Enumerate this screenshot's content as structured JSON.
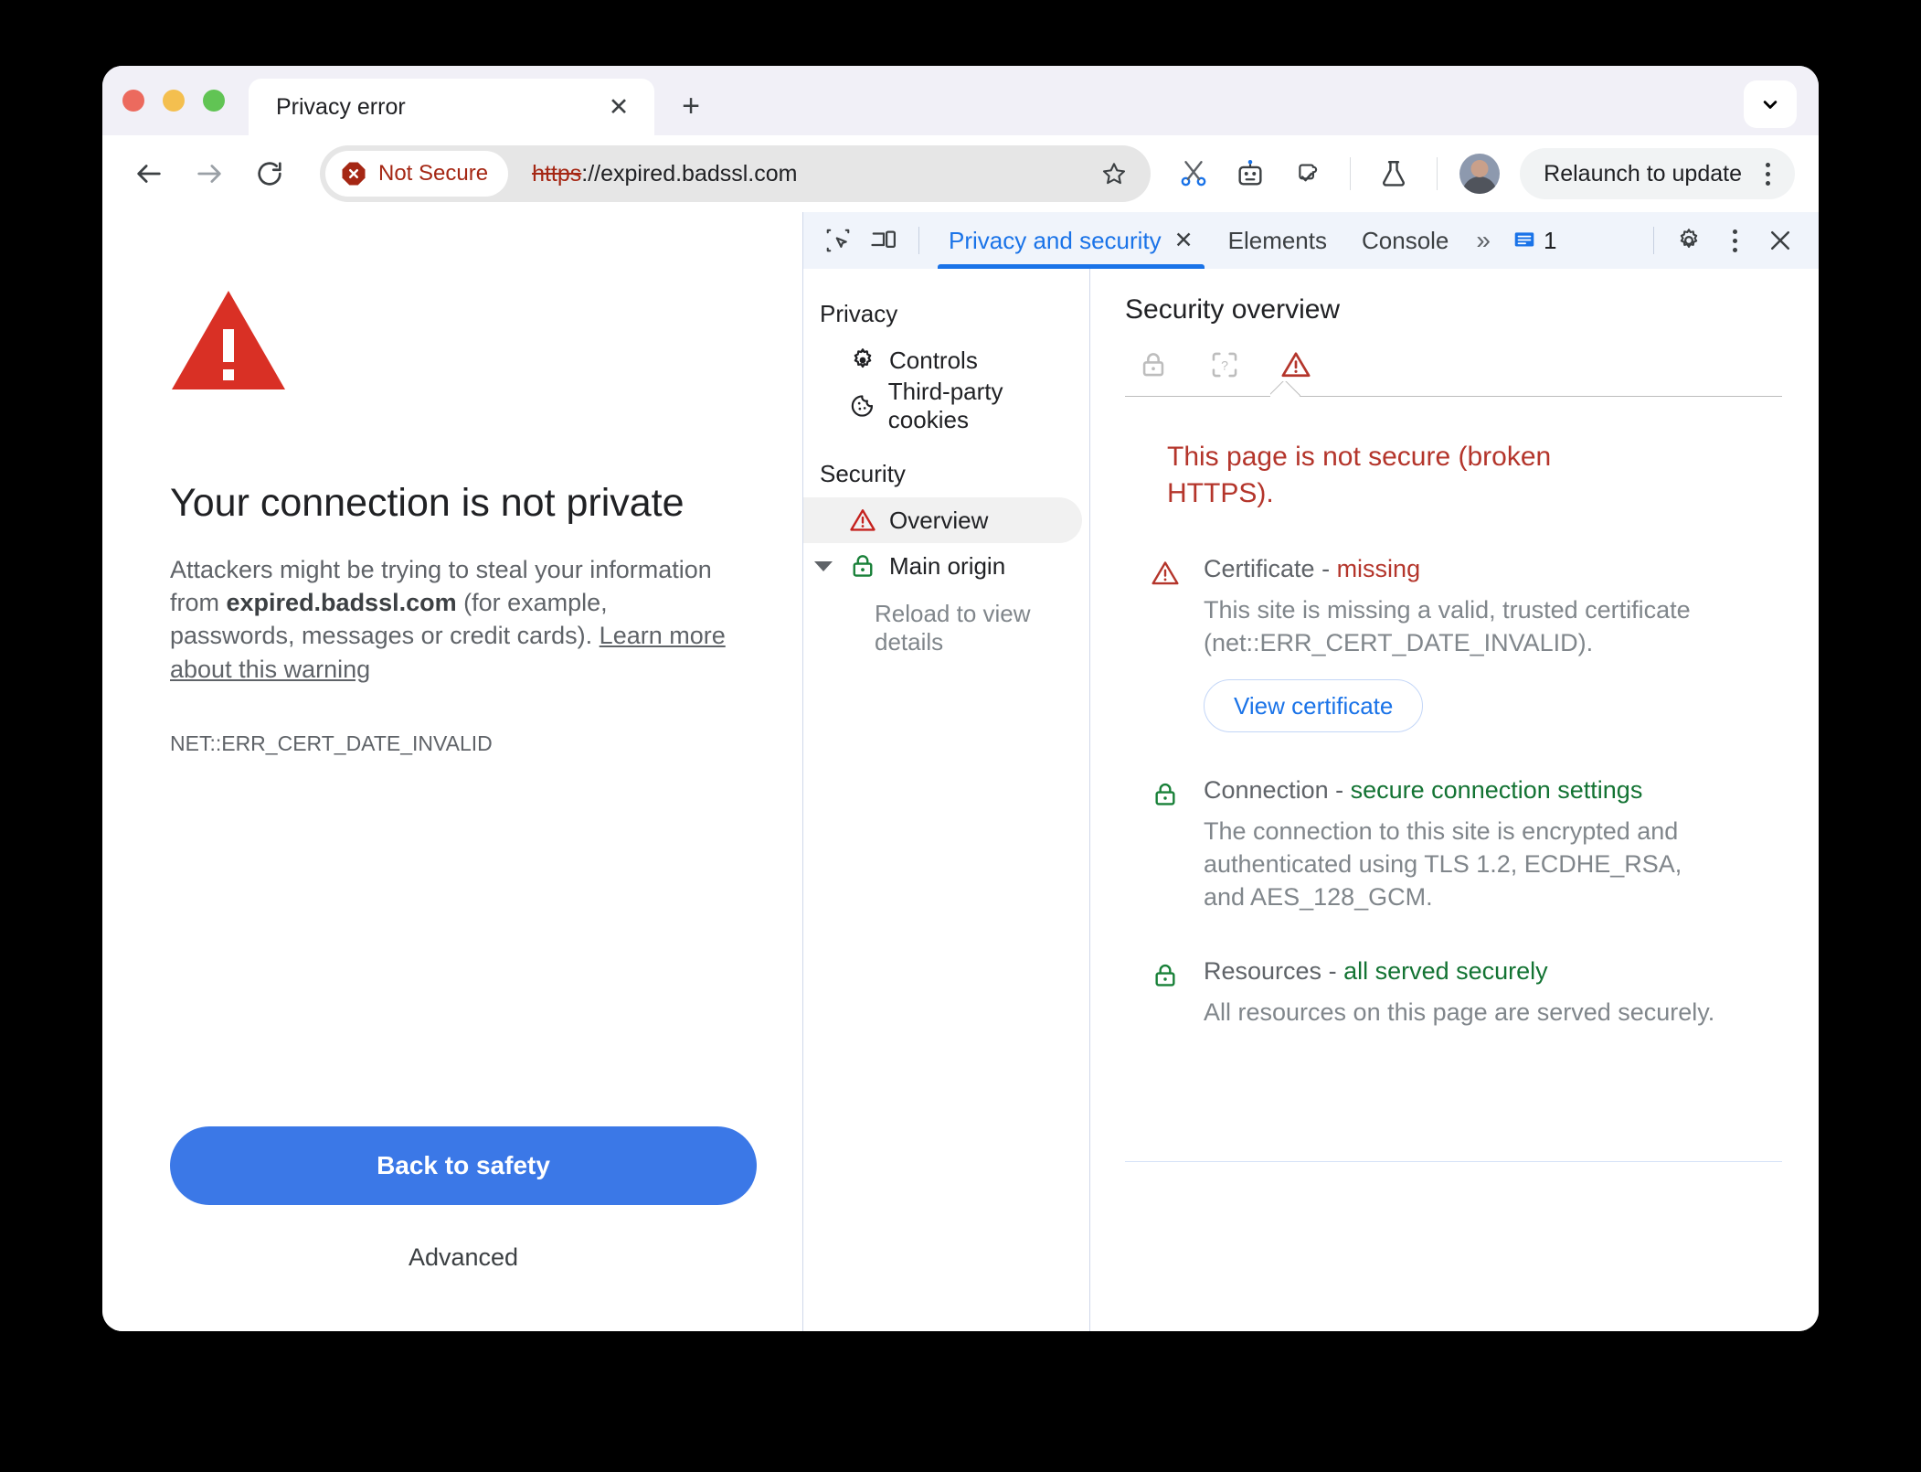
{
  "window": {
    "traffic_lights": [
      "close",
      "minimize",
      "maximize"
    ]
  },
  "tabstrip": {
    "tab_title": "Privacy error",
    "close_label": "✕",
    "new_tab_label": "+",
    "tab_search_icon": "chevron-down-icon"
  },
  "toolbar": {
    "back_icon": "back-arrow-icon",
    "forward_icon": "forward-arrow-icon",
    "reload_icon": "reload-icon",
    "security_badge": "Not Secure",
    "url_scheme": "https",
    "url_rest": "://expired.badssl.com",
    "bookmark_icon": "star-icon",
    "extension_icons": [
      "scissors-icon",
      "robot-icon",
      "puzzle-icon",
      "flask-icon"
    ],
    "profile_icon": "avatar",
    "relaunch_label": "Relaunch to update",
    "menu_icon": "kebab-menu-icon",
    "accent_red": "#a52714"
  },
  "page": {
    "warning_icon": "red-warning-triangle",
    "heading": "Your connection is not private",
    "paragraph_part1": "Attackers might be trying to steal your information from ",
    "paragraph_host": "expired.badssl.com",
    "paragraph_part2": " (for example, passwords, messages or credit cards). ",
    "learn_more_link": "Learn more about this warning",
    "error_code": "NET::ERR_CERT_DATE_INVALID",
    "primary_button": "Back to safety",
    "advanced_link": "Advanced",
    "button_color": "#3b78e7"
  },
  "devtools": {
    "inspect_icon": "inspect-element-icon",
    "device_icon": "device-toolbar-icon",
    "tabs": [
      {
        "label": "Privacy and security",
        "active": true,
        "closable": true
      },
      {
        "label": "Elements",
        "active": false,
        "closable": false
      },
      {
        "label": "Console",
        "active": false,
        "closable": false
      }
    ],
    "more_tabs_icon": "double-chevron-right-icon",
    "message_icon": "message-icon",
    "message_count": "1",
    "settings_icon": "gear-icon",
    "more_options_icon": "kebab-menu-icon",
    "close_icon": "close-icon",
    "accent_blue": "#1a73e8",
    "sidebar": {
      "groups": [
        {
          "header": "Privacy",
          "items": [
            {
              "label": "Controls",
              "icon": "gear-icon",
              "selected": false
            },
            {
              "label": "Third-party cookies",
              "icon": "cookie-icon",
              "selected": false
            }
          ]
        },
        {
          "header": "Security",
          "items": [
            {
              "label": "Overview",
              "icon": "warning-triangle-icon",
              "selected": true
            },
            {
              "label": "Main origin",
              "icon": "green-lock-icon",
              "selected": false,
              "expandable": true
            }
          ]
        }
      ],
      "sub_note": "Reload to view details"
    },
    "overview": {
      "title": "Security overview",
      "state_icons": [
        {
          "name": "lock-icon",
          "state": "inactive"
        },
        {
          "name": "unknown-state-icon",
          "state": "inactive"
        },
        {
          "name": "warning-triangle-icon",
          "state": "active"
        }
      ],
      "summary": "This page is not secure (broken HTTPS).",
      "sections": [
        {
          "icon": "warning-triangle-icon",
          "title_label": "Certificate",
          "title_value": "missing",
          "value_tone": "bad",
          "description": "This site is missing a valid, trusted certificate (net::ERR_CERT_DATE_INVALID).",
          "button": "View certificate"
        },
        {
          "icon": "green-lock-icon",
          "title_label": "Connection",
          "title_value": "secure connection settings",
          "value_tone": "good",
          "description": "The connection to this site is encrypted and authenticated using TLS 1.2, ECDHE_RSA, and AES_128_GCM.",
          "button": null
        },
        {
          "icon": "green-lock-icon",
          "title_label": "Resources",
          "title_value": "all served securely",
          "value_tone": "good",
          "description": "All resources on this page are served securely.",
          "button": null
        }
      ]
    }
  }
}
